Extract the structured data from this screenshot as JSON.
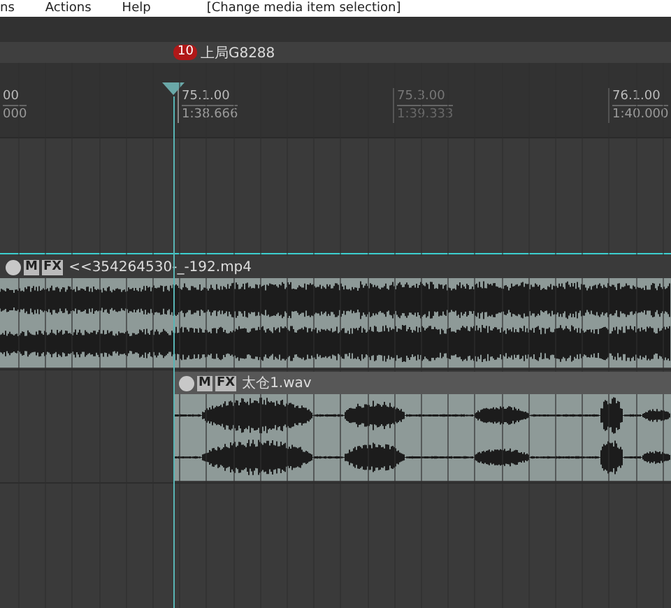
{
  "menu": [
    {
      "label": "ns"
    },
    {
      "label": "Actions"
    },
    {
      "label": "Help"
    }
  ],
  "status": "[Change media item selection]",
  "marker": {
    "number": "10",
    "label": "上局G8288"
  },
  "ruler": [
    {
      "measure": "00",
      "time": "000",
      "kind": "major"
    },
    {
      "measure": "75.1.00",
      "time": "1:38.666",
      "kind": "major"
    },
    {
      "measure": "75.3.00",
      "time": "1:39.333",
      "kind": "minor"
    },
    {
      "measure": "76.1.00",
      "time": "1:40.000",
      "kind": "major"
    }
  ],
  "tracks": [
    {
      "kind": "empty"
    },
    {
      "kind": "item",
      "item": {
        "name": "<<354264530-_-192.mp4",
        "mute": "M",
        "fx": "FX"
      }
    },
    {
      "kind": "item",
      "item": {
        "name": "太仓1.wav",
        "mute": "M",
        "fx": "FX"
      }
    },
    {
      "kind": "empty"
    }
  ]
}
